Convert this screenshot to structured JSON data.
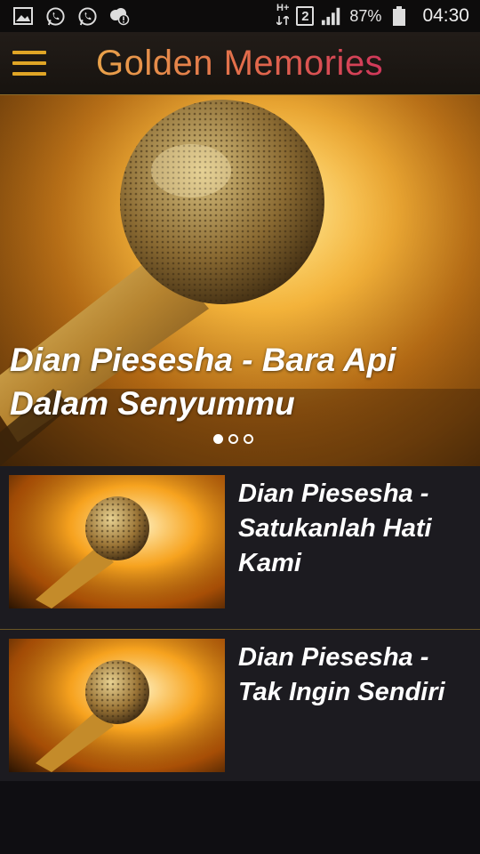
{
  "status_bar": {
    "icons_left": [
      "image-icon",
      "whatsapp-icon",
      "whatsapp-icon",
      "wifi-alert-icon"
    ],
    "network_type": "H+",
    "sim_slot": "2",
    "battery_percent": "87%",
    "time": "04:30"
  },
  "app_bar": {
    "menu_icon": "hamburger-icon",
    "title": "Golden Memories",
    "title_colors": [
      "#e9a24a",
      "#e2694b",
      "#d0375a"
    ],
    "accent_color": "#e0a526"
  },
  "hero": {
    "title": "Dian Piesesha - Bara Api Dalam Senyummu",
    "image": "microphone-image",
    "carousel": {
      "count": 3,
      "active_index": 0
    }
  },
  "songs": [
    {
      "title": "Dian Piesesha - Satukanlah Hati Kami",
      "thumbnail": "microphone-image"
    },
    {
      "title": "Dian Piesesha - Tak Ingin Sendiri",
      "thumbnail": "microphone-image"
    }
  ]
}
